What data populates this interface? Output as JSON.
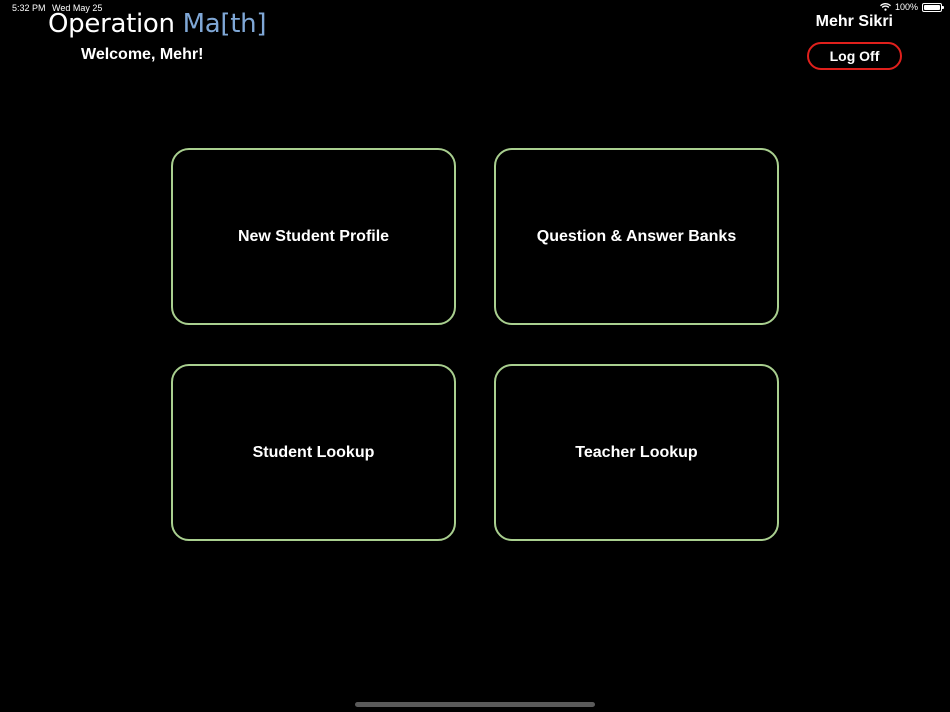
{
  "status_bar": {
    "time": "5:32 PM",
    "date": "Wed May 25",
    "battery": "100%",
    "battery_level": 1.0,
    "wifi_icon": "wifi-icon"
  },
  "header": {
    "title_main": "Operation ",
    "title_accent": "Ma[th]",
    "accent_color": "#7fa7d6",
    "welcome": "Welcome, Mehr!",
    "user_name": "Mehr Sikri",
    "logoff_label": "Log Off",
    "logoff_border_color": "#e0201c"
  },
  "tiles": [
    {
      "label": "New Student Profile"
    },
    {
      "label": "Question & Answer Banks"
    },
    {
      "label": "Student Lookup"
    },
    {
      "label": "Teacher Lookup"
    }
  ],
  "colors": {
    "background": "#000000",
    "tile_border": "#a9cf8f"
  }
}
